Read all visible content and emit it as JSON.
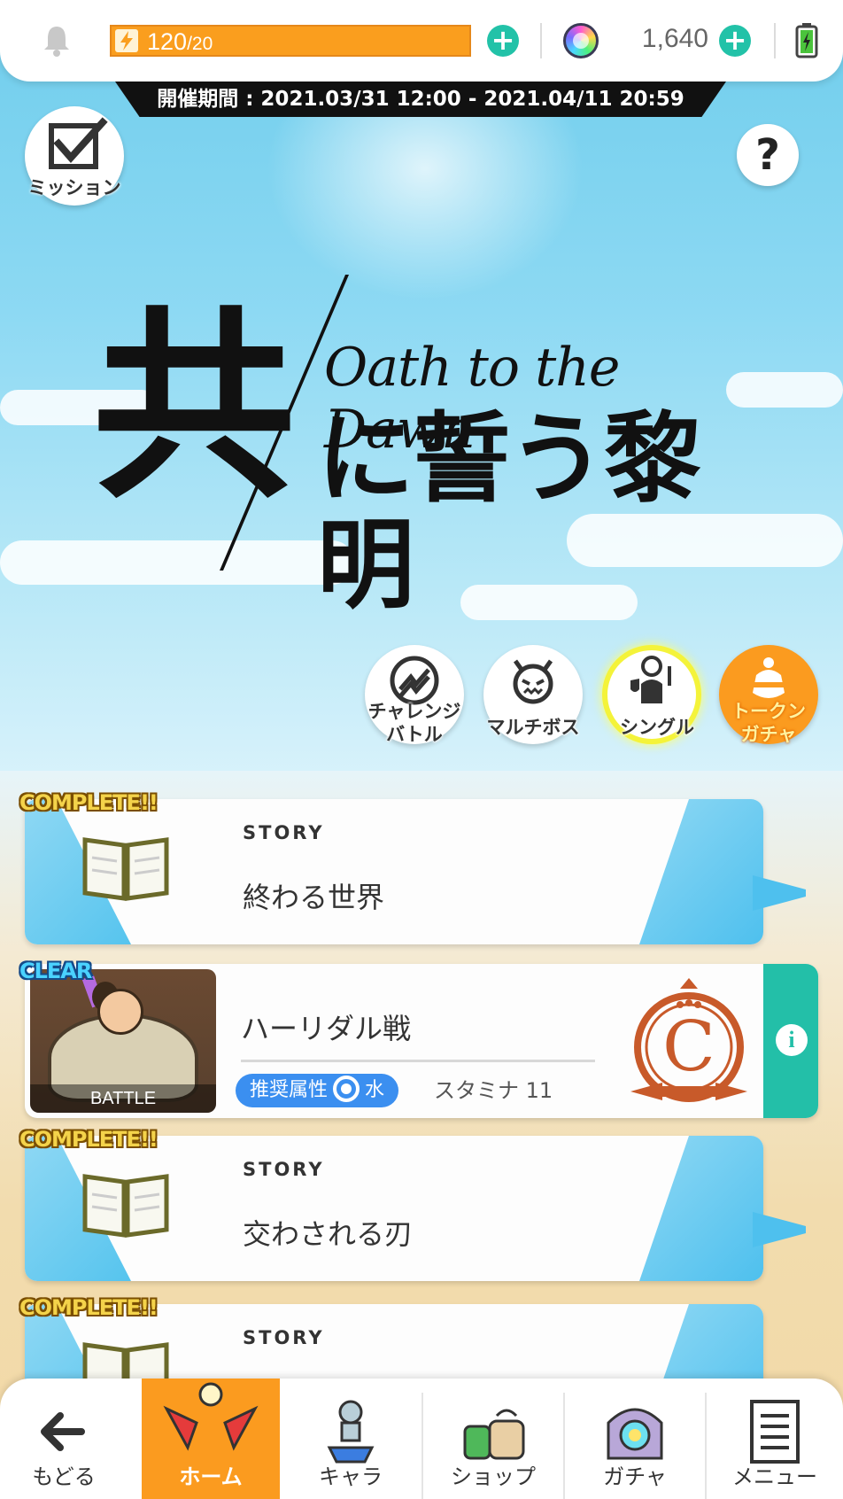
{
  "header": {
    "stamina_current": "120",
    "stamina_max": "/20",
    "gem_count": "1,640"
  },
  "event_period": "開催期間 : 2021.03/31 12:00 - 2021.04/11 20:59",
  "mission_label": "ミッション",
  "help_label": "?",
  "logo": {
    "kanji": "共",
    "subtitle": "Oath to the Dawn",
    "main": "に誓う黎明"
  },
  "modes": [
    {
      "label_line1": "チャレンジ",
      "label_line2": "バトル",
      "icon": "chart-trend-icon"
    },
    {
      "label_line1": "マルチボス",
      "label_line2": "",
      "icon": "demon-face-icon"
    },
    {
      "label_line1": "シングル",
      "label_line2": "",
      "icon": "single-hero-icon"
    },
    {
      "label_line1": "トークン",
      "label_line2": "ガチャ",
      "icon": "token-bag-icon"
    }
  ],
  "quests": {
    "q1": {
      "badge": "COMPLETE!!",
      "label": "STORY",
      "title": "終わる世界"
    },
    "battle": {
      "badge": "CLEAR",
      "thumb_label": "BATTLE",
      "title": "ハーリダル戦",
      "element_prefix": "推奨属性",
      "element": "水",
      "stamina": "スタミナ 11",
      "rank": "C"
    },
    "q2": {
      "badge": "COMPLETE!!",
      "label": "STORY",
      "title": "交わされる刃"
    },
    "q3": {
      "badge": "COMPLETE!!",
      "label": "STORY",
      "title": ""
    }
  },
  "nav": {
    "back": "もどる",
    "home": "ホーム",
    "chara": "キャラ",
    "shop": "ショップ",
    "gacha": "ガチャ",
    "menu": "メニュー"
  },
  "colors": {
    "accent_orange": "#fb9b1f",
    "accent_teal": "#23bfa8",
    "story_blue": "#4ec0ee"
  }
}
